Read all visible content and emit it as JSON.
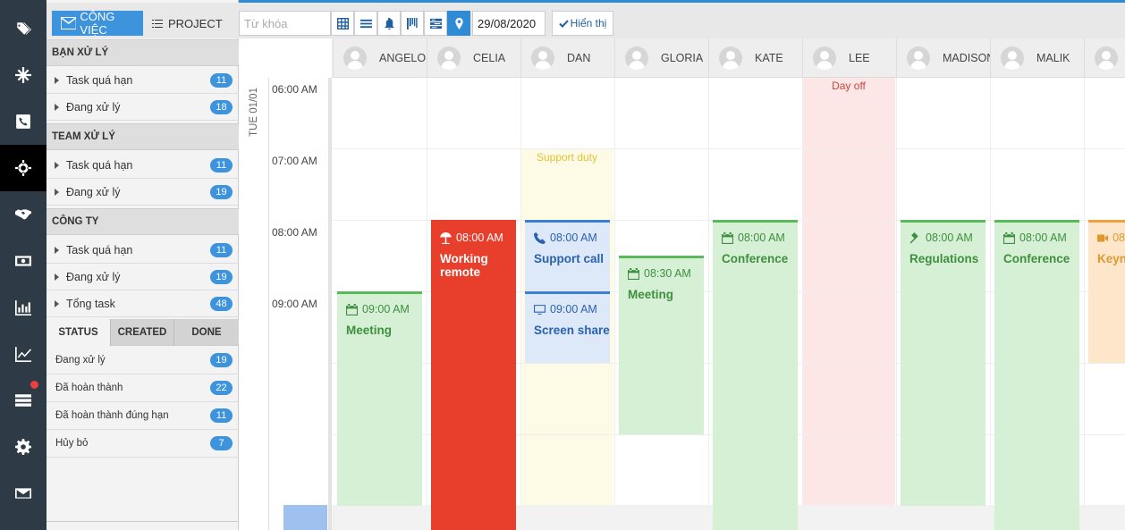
{
  "rail": {
    "items": [
      {
        "icon": "tags-icon"
      },
      {
        "icon": "snowflake-icon"
      },
      {
        "icon": "phone-icon"
      },
      {
        "icon": "crosshair-icon",
        "active": true
      },
      {
        "icon": "handshake-icon"
      },
      {
        "icon": "money-icon"
      },
      {
        "icon": "bar-chart-icon"
      },
      {
        "icon": "line-chart-icon"
      },
      {
        "icon": "list-icon",
        "notification": true
      },
      {
        "icon": "gear-icon"
      },
      {
        "icon": "mail-icon"
      }
    ]
  },
  "panel": {
    "tabs": {
      "work": "CÔNG VIỆC",
      "project": "PROJECT"
    },
    "sections": [
      {
        "title": "BẠN XỬ LÝ",
        "rows": [
          {
            "label": "Task quá hạn",
            "count": "11"
          },
          {
            "label": "Đang xử lý",
            "count": "18"
          }
        ]
      },
      {
        "title": "TEAM XỬ LÝ",
        "rows": [
          {
            "label": "Task quá hạn",
            "count": "11"
          },
          {
            "label": "Đang xử lý",
            "count": "19"
          }
        ]
      },
      {
        "title": "CÔNG TY",
        "rows": [
          {
            "label": "Task quá hạn",
            "count": "11"
          },
          {
            "label": "Đang xử lý",
            "count": "19"
          },
          {
            "label": "Tổng task",
            "count": "48"
          }
        ]
      }
    ],
    "subtabs": {
      "status": "STATUS",
      "created": "CREATED",
      "done": "DONE"
    },
    "status_rows": [
      {
        "label": "Đang xử lý",
        "count": "19"
      },
      {
        "label": "Đã hoàn thành",
        "count": "22"
      },
      {
        "label": "Đã hoàn thành đúng hạn",
        "count": "11"
      },
      {
        "label": "Hủy bỏ",
        "count": "7"
      }
    ]
  },
  "toolbar": {
    "search_placeholder": "Từ khóa",
    "date_value": "29/08/2020",
    "show_label": "Hiển thị"
  },
  "calendar": {
    "day_label": "TUE 01/01",
    "times": [
      "06:00 AM",
      "07:00 AM",
      "08:00 AM",
      "09:00 AM"
    ],
    "people": [
      "ANGELO",
      "CELIA",
      "DAN",
      "GLORIA",
      "KATE",
      "LEE",
      "MADISON",
      "MALIK",
      ""
    ],
    "bands": {
      "support_duty": "Support duty",
      "day_off": "Day off"
    },
    "events": {
      "angelo": {
        "time": "09:00 AM",
        "title": "Meeting"
      },
      "celia": {
        "time": "08:00 AM",
        "title": "Working remote"
      },
      "dan_support": {
        "time": "08:00 AM",
        "title": "Support call"
      },
      "dan_screen": {
        "time": "09:00 AM",
        "title": "Screen share"
      },
      "gloria": {
        "time": "08:30 AM",
        "title": "Meeting"
      },
      "kate": {
        "time": "08:00 AM",
        "title": "Conference"
      },
      "madison": {
        "time": "08:00 AM",
        "title": "Regulations"
      },
      "malik": {
        "time": "08:00 AM",
        "title": "Conference"
      },
      "last": {
        "time": "08",
        "title": "Keyno"
      }
    }
  },
  "colors": {
    "accent": "#3d93dc",
    "rail": "#2e3a46",
    "event_red": "#e73f2b",
    "event_green": "#d6f0d6"
  }
}
